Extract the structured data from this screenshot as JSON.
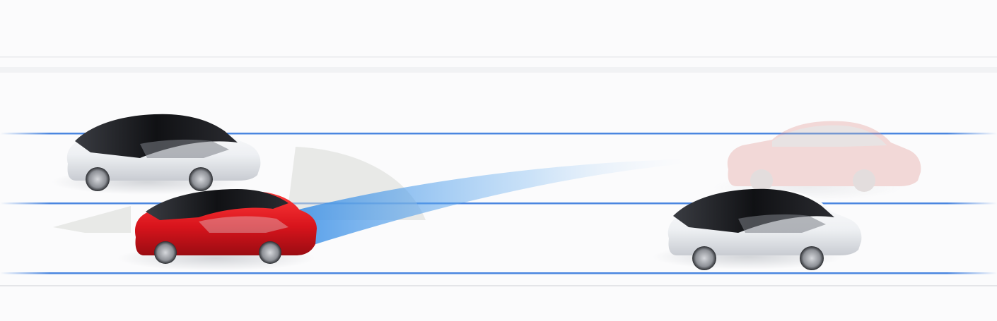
{
  "scene": {
    "background": "#fbfbfc",
    "lane_line_color": "#4a86e0",
    "curb_color": "#e6e7ea",
    "radar_color": "#3a8fe6",
    "sensor_zone_color": "#d9dbd6",
    "ego_car_color": "#d8141c",
    "other_car_color": "#f4f5f7",
    "ghost_car_color": "#e49a94",
    "window_color": "#1c1d20",
    "wheel_color": "#2b2d31"
  }
}
